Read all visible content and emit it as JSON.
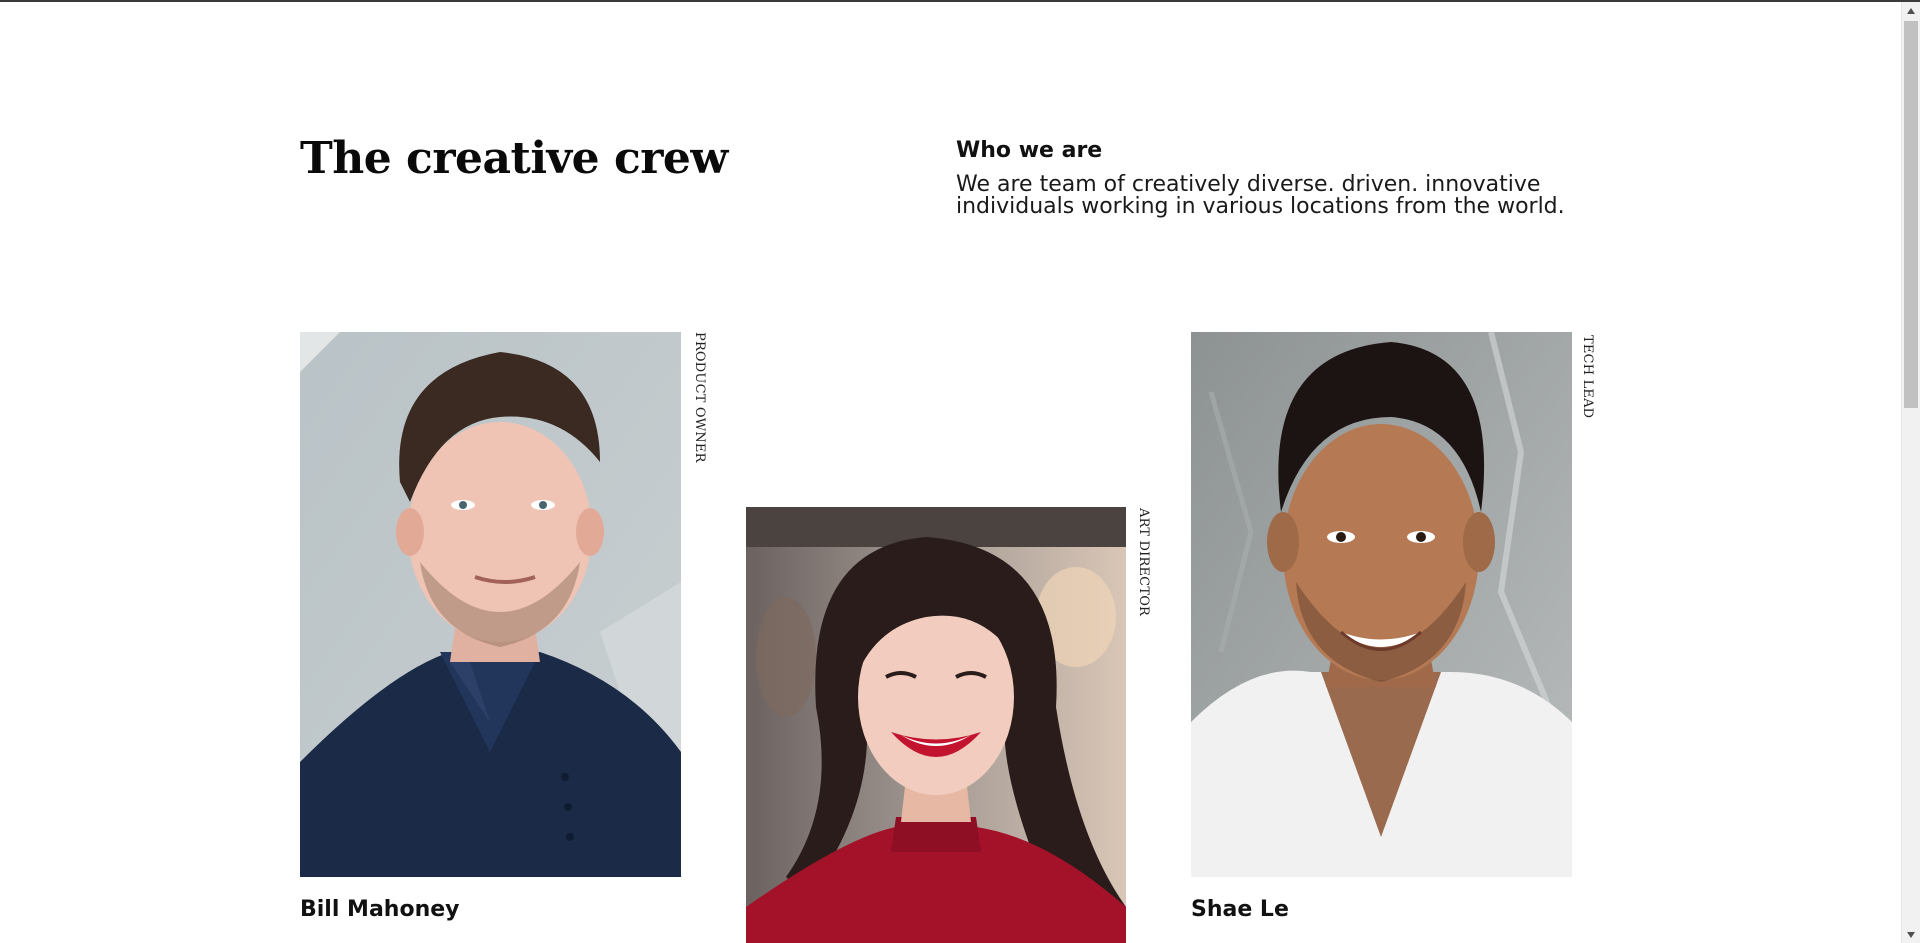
{
  "header": {
    "title": "The creative crew",
    "about_heading": "Who we are",
    "about_text": "We are team of creatively diverse. driven. innovative individuals working in various locations from the world."
  },
  "team": [
    {
      "name": "Bill Mahoney",
      "role": "PRODUCT OWNER"
    },
    {
      "name": "",
      "role": "ART DIRECTOR"
    },
    {
      "name": "Shae Le",
      "role": "TECH LEAD"
    }
  ],
  "colors": {
    "text": "#111111",
    "background": "#ffffff",
    "scrollbar_track": "#f1f1f1",
    "scrollbar_thumb": "#c1c1c1"
  }
}
